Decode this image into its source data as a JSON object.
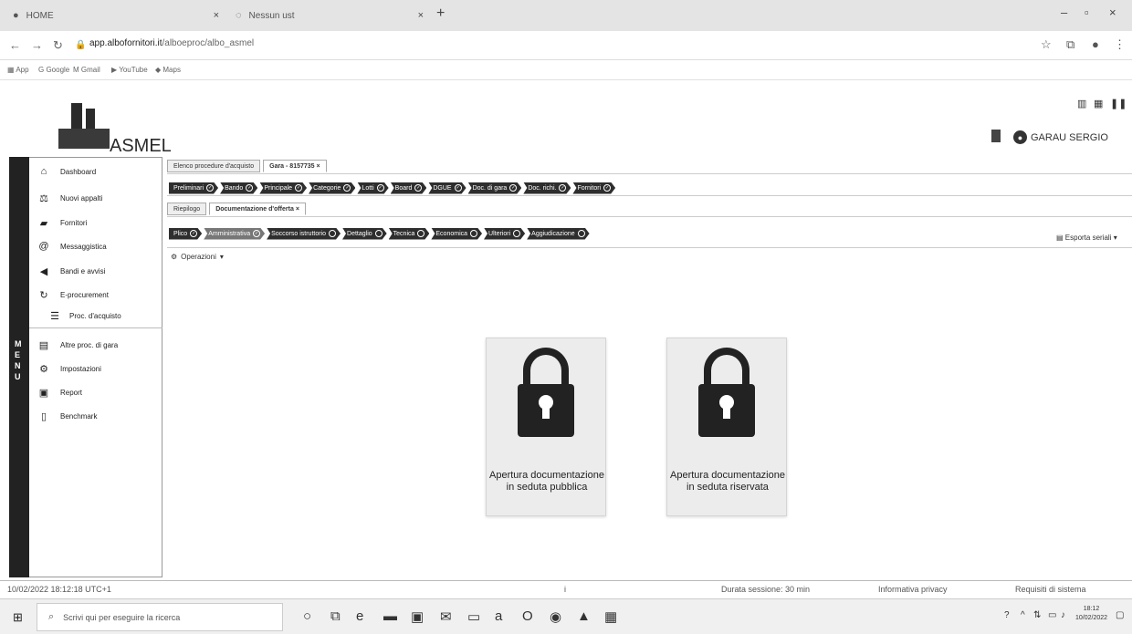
{
  "browser": {
    "tabs": [
      {
        "title": "HOME",
        "icon": "globe-icon"
      },
      {
        "title": "Nessun ust",
        "icon": "loading-icon"
      }
    ],
    "url_domain": "app.albofornitori.it",
    "url_path": "/alboeproc/albo_asmel",
    "bookmarks": [
      "App",
      "Google",
      "Gmail",
      "YouTube",
      "Maps"
    ]
  },
  "header": {
    "logo_text": "ASMEL",
    "user_name": "GARAU SERGIO"
  },
  "menu_label": "MENU",
  "sidebar": {
    "items": [
      {
        "label": "Dashboard",
        "icon": "home-icon"
      },
      {
        "label": "Nuovi appalti",
        "icon": "scales-icon"
      },
      {
        "label": "Fornitori",
        "icon": "truck-icon"
      },
      {
        "label": "Messaggistica",
        "icon": "at-icon"
      },
      {
        "label": "Bandi e avvisi",
        "icon": "megaphone-icon"
      },
      {
        "label": "E-procurement",
        "icon": "refresh-icon"
      },
      {
        "label": "Proc. d'acquisto",
        "icon": "list-icon"
      },
      {
        "label": "Altre proc. di gara",
        "icon": "folder-icon"
      },
      {
        "label": "Impostazioni",
        "icon": "gear-icon"
      },
      {
        "label": "Report",
        "icon": "chart-icon"
      },
      {
        "label": "Benchmark",
        "icon": "document-icon"
      }
    ]
  },
  "tabs": {
    "main": [
      "Elenco procedure d'acquisto",
      "Gara - 8157735"
    ],
    "steps": [
      "Preliminari",
      "Bando",
      "Principale",
      "Categorie",
      "Lotti",
      "Board",
      "DGUE",
      "Doc. di gara",
      "Doc. richi.",
      "Fornitori"
    ],
    "sub": [
      "Riepilogo",
      "Documentazione d'offerta"
    ],
    "phases": [
      "Plico",
      "Amministrativa",
      "Soccorso istruttorio",
      "Dettaglio",
      "Tecnica",
      "Economica",
      "Ulteriori",
      "Aggiudicazione"
    ],
    "export_label": "Esporta seriali",
    "operations_label": "Operazioni"
  },
  "cards": [
    {
      "label": "Apertura documentazione in seduta pubblica",
      "icon": "lock-icon"
    },
    {
      "label": "Apertura documentazione in seduta riservata",
      "icon": "lock-icon"
    }
  ],
  "status_bar": {
    "timestamp": "10/02/2022 18:12:18 UTC+1",
    "session": "Durata sessione: 30 min",
    "privacy": "Informativa privacy",
    "requirements": "Requisiti di sistema"
  },
  "taskbar": {
    "search_placeholder": "Scrivi qui per eseguire la ricerca",
    "time": "18:12",
    "date": "10/02/2022"
  }
}
